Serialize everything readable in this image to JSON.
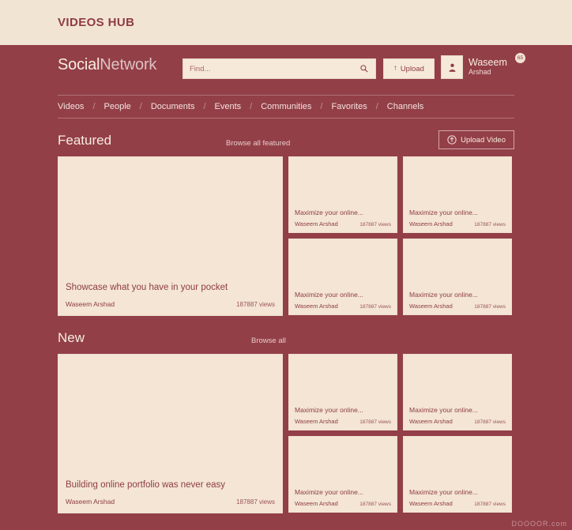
{
  "topbar": {
    "title": "VIDEOS HUB"
  },
  "header": {
    "logo_bold": "Social",
    "logo_light": "Network",
    "search": {
      "placeholder": "Find...",
      "value": "",
      "icon": "search-icon"
    },
    "upload_button": {
      "label": "Upload",
      "icon": "upload-arrow-icon"
    },
    "user": {
      "first_name": "Waseem",
      "last_name": "Arshad",
      "badge": "65",
      "avatar_icon": "person-icon"
    }
  },
  "nav": {
    "separator": "/",
    "items": [
      {
        "label": "Videos"
      },
      {
        "label": "People"
      },
      {
        "label": "Documents"
      },
      {
        "label": "Events"
      },
      {
        "label": "Communities"
      },
      {
        "label": "Favorites"
      },
      {
        "label": "Channels"
      }
    ]
  },
  "sections": [
    {
      "title": "Featured",
      "browse_label": "Browse all featured",
      "action_button": {
        "label": "Upload Video",
        "icon": "circle-up-arrow-icon"
      },
      "feature_card": {
        "title": "Showcase what you have in your pocket",
        "author": "Waseem Arshad",
        "views": "187887 views"
      },
      "cards": [
        {
          "title": "Maximize your online...",
          "author": "Waseem Arshad",
          "views": "187887 views"
        },
        {
          "title": "Maximize your online...",
          "author": "Waseem Arshad",
          "views": "187887 views"
        },
        {
          "title": "Maximize your online...",
          "author": "Waseem Arshad",
          "views": "187887 views"
        },
        {
          "title": "Maximize your online...",
          "author": "Waseem Arshad",
          "views": "187887 views"
        }
      ]
    },
    {
      "title": "New",
      "browse_label": "Browse all",
      "feature_card": {
        "title": "Building online portfolio was never easy",
        "author": "Waseem Arshad",
        "views": "187887 views"
      },
      "cards": [
        {
          "title": "Maximize your online...",
          "author": "Waseem Arshad",
          "views": "187887 views"
        },
        {
          "title": "Maximize your online...",
          "author": "Waseem Arshad",
          "views": "187887 views"
        },
        {
          "title": "Maximize your online...",
          "author": "Waseem Arshad",
          "views": "187887 views"
        },
        {
          "title": "Maximize your online...",
          "author": "Waseem Arshad",
          "views": "187887 views"
        }
      ]
    }
  ],
  "watermark": "DOOOOR.com",
  "colors": {
    "background": "#933f48",
    "banner": "#f2e4d3",
    "card": "#f4e5d4",
    "accent_text": "#8e3c43",
    "light_text": "#f7ece0"
  }
}
